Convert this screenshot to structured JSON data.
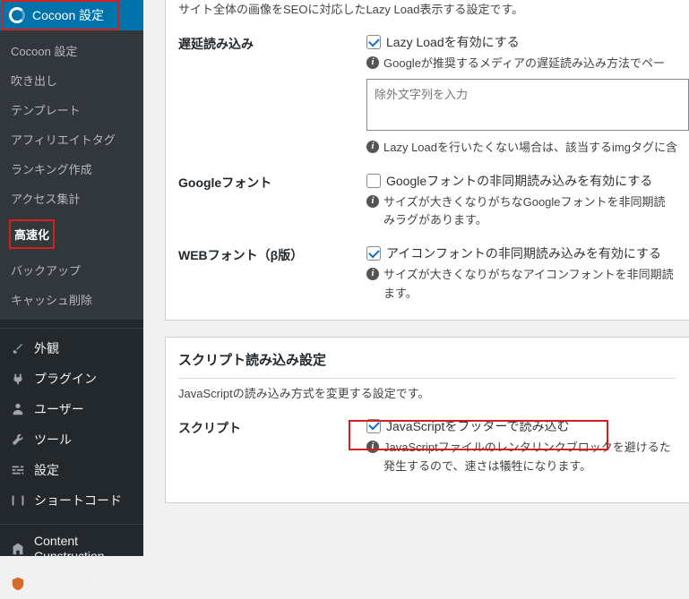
{
  "sidebar": {
    "top": "Cocoon 設定",
    "sub": [
      "Cocoon 設定",
      "吹き出し",
      "テンプレート",
      "アフィリエイトタグ",
      "ランキング作成",
      "アクセス集計",
      "高速化",
      "バックアップ",
      "キャッシュ削除"
    ],
    "main": [
      {
        "icon": "brush",
        "label": "外観"
      },
      {
        "icon": "plug",
        "label": "プラグイン"
      },
      {
        "icon": "user",
        "label": "ユーザー"
      },
      {
        "icon": "wrench",
        "label": "ツール"
      },
      {
        "icon": "sliders",
        "label": "設定"
      },
      {
        "icon": "brackets",
        "label": "ショートコード"
      }
    ],
    "extra": [
      {
        "icon": "building",
        "label": "Content Cunstruction"
      },
      {
        "icon": "shield",
        "label": "SiteGuard"
      }
    ]
  },
  "panel1": {
    "intro": "サイト全体の画像をSEOに対応したLazy Load表示する設定です。",
    "r1": {
      "label": "遅延読み込み",
      "chk": "Lazy Loadを有効にする",
      "help1": "Googleが推奨するメディアの遅延読み込み方法でペー",
      "placeholder": "除外文字列を入力",
      "help2": "Lazy Loadを行いたくない場合は、該当するimgタグに含"
    },
    "r2": {
      "label": "Googleフォント",
      "chk": "Googleフォントの非同期読み込みを有効にする",
      "help": "サイズが大きくなりがちなGoogleフォントを非同期読みラグがあります。"
    },
    "r3": {
      "label": "WEBフォント（β版）",
      "chk": "アイコンフォントの非同期読み込みを有効にする",
      "help": "サイズが大きくなりがちなアイコンフォントを非同期読ます。"
    }
  },
  "panel2": {
    "header": "スクリプト読み込み設定",
    "intro": "JavaScriptの読み込み方式を変更する設定です。",
    "r1": {
      "label": "スクリプト",
      "chk": "JavaScriptをフッターで読み込む",
      "help": "JavaScriptファイルのレンタリンクブロックを避けるた発生するので、速さは犠牲になります。"
    }
  }
}
